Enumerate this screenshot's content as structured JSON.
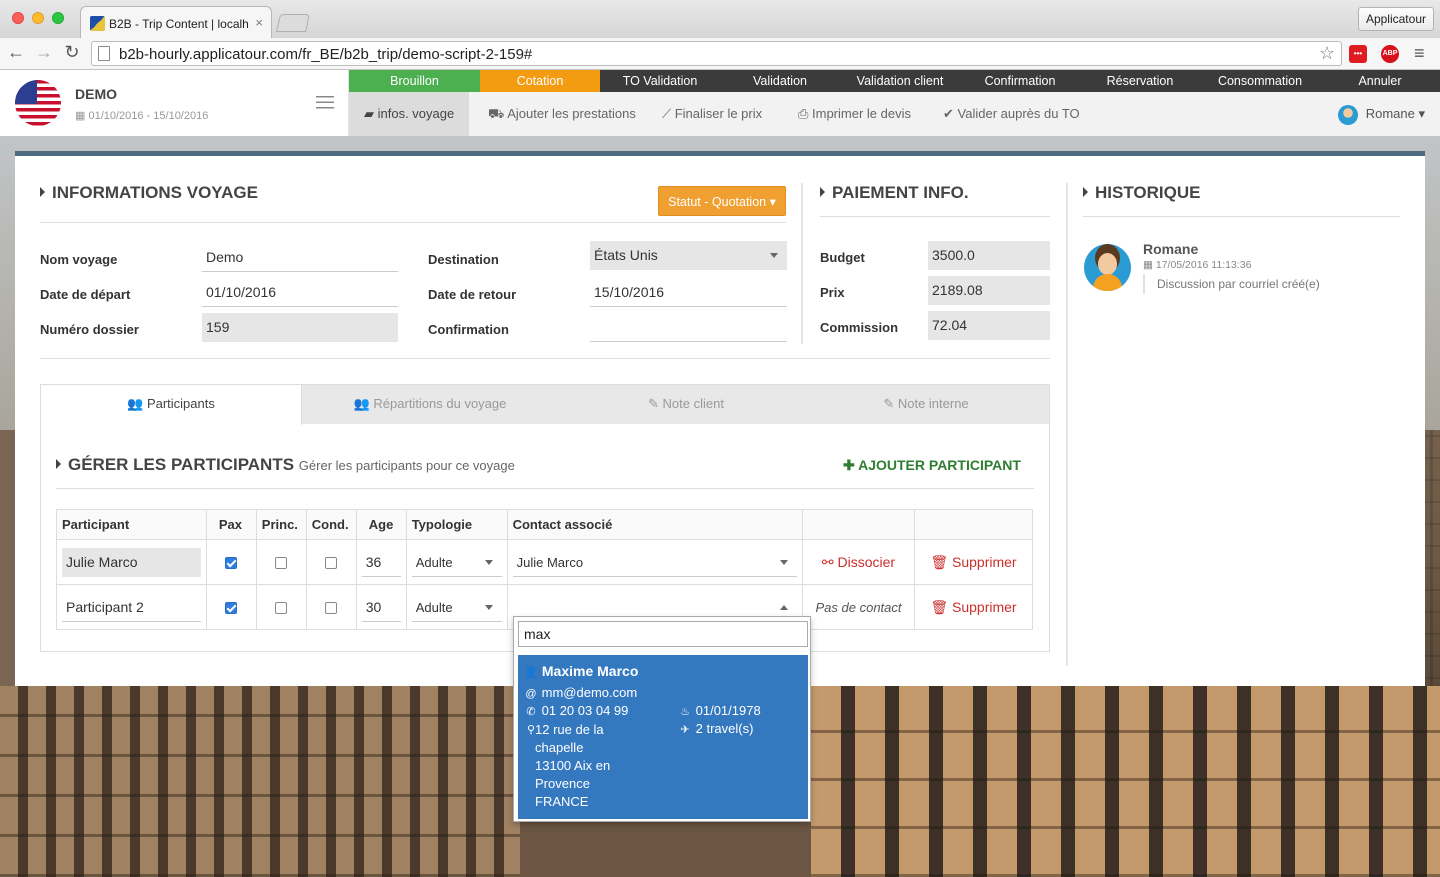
{
  "browser": {
    "tab_title": "B2B - Trip Content | localh",
    "tab_close": "×",
    "profile_button": "Applicatour",
    "url": "b2b-hourly.applicatour.com/fr_BE/b2b_trip/demo-script-2-159#",
    "ext_1": "•••",
    "ext_2": "ABP",
    "icons": {
      "back": "←",
      "forward": "→",
      "reload": "↻",
      "bookmark": "☆",
      "menu": "≡"
    }
  },
  "trip": {
    "name": "DEMO",
    "dates": "01/10/2016 - 15/10/2016"
  },
  "workflow_steps": [
    {
      "label": "Brouillon",
      "color": "#4caf50"
    },
    {
      "label": "Cotation",
      "color": "#f39c12"
    },
    {
      "label": "TO Validation"
    },
    {
      "label": "Validation"
    },
    {
      "label": "Validation client"
    },
    {
      "label": "Confirmation"
    },
    {
      "label": "Réservation"
    },
    {
      "label": "Consommation"
    },
    {
      "label": "Annuler"
    }
  ],
  "actions": [
    {
      "label": "infos. voyage",
      "icon": "briefcase-icon"
    },
    {
      "label": "Ajouter les prestations",
      "icon": "cart-icon"
    },
    {
      "label": "Finaliser le prix",
      "icon": "chart-icon"
    },
    {
      "label": "Imprimer le devis",
      "icon": "print-icon"
    },
    {
      "label": "Valider auprès du TO",
      "icon": "check-icon"
    }
  ],
  "user": {
    "name": "Romane"
  },
  "info": {
    "title": "INFORMATIONS VOYAGE",
    "status_button": "Statut - Quotation",
    "fields": {
      "nom_voyage": {
        "label": "Nom voyage",
        "value": "Demo"
      },
      "date_depart": {
        "label": "Date de départ",
        "value": "01/10/2016"
      },
      "numero_dossier": {
        "label": "Numéro dossier",
        "value": "159"
      },
      "destination": {
        "label": "Destination",
        "value": "États Unis"
      },
      "date_retour": {
        "label": "Date de retour",
        "value": "15/10/2016"
      },
      "confirmation": {
        "label": "Confirmation",
        "value": ""
      }
    }
  },
  "paiement": {
    "title": "PAIEMENT INFO.",
    "budget": {
      "label": "Budget",
      "value": "3500.0"
    },
    "prix": {
      "label": "Prix",
      "value": "2189.08"
    },
    "commission": {
      "label": "Commission",
      "value": "72.04"
    }
  },
  "historique": {
    "title": "HISTORIQUE",
    "entry": {
      "author": "Romane",
      "datetime": "17/05/2016 11:13:36",
      "text": "Discussion par courriel créé(e)"
    }
  },
  "tabs": [
    {
      "label": "Participants",
      "icon": "users-icon"
    },
    {
      "label": "Répartitions du voyage",
      "icon": "users-icon"
    },
    {
      "label": "Note client",
      "icon": "pencil-icon"
    },
    {
      "label": "Note interne",
      "icon": "pencil-icon"
    }
  ],
  "participants": {
    "title": "GÉRER LES PARTICIPANTS",
    "subtitle": "Gérer les participants pour ce voyage",
    "add_button": "AJOUTER PARTICIPANT",
    "columns": [
      "Participant",
      "Pax",
      "Princ.",
      "Cond.",
      "Age",
      "Typologie",
      "Contact associé",
      "",
      ""
    ],
    "rows": [
      {
        "name": "Julie Marco",
        "pax": true,
        "princ": false,
        "cond": false,
        "age": "36",
        "typologie": "Adulte",
        "contact": "Julie Marco",
        "action": "Dissocier",
        "delete": "Supprimer"
      },
      {
        "name": "Participant 2",
        "pax": true,
        "princ": false,
        "cond": false,
        "age": "30",
        "typologie": "Adulte",
        "contact": "",
        "action": "Pas de contact",
        "delete": "Supprimer"
      }
    ]
  },
  "dropdown": {
    "search_value": "max",
    "result": {
      "name": "Maxime Marco",
      "email": "mm@demo.com",
      "phone": "01 20 03 04 99",
      "birthdate": "01/01/1978",
      "address_lines": [
        "12 rue de la",
        "chapelle",
        "13100 Aix en",
        "Provence",
        "FRANCE"
      ],
      "travels": "2 travel(s)"
    }
  }
}
